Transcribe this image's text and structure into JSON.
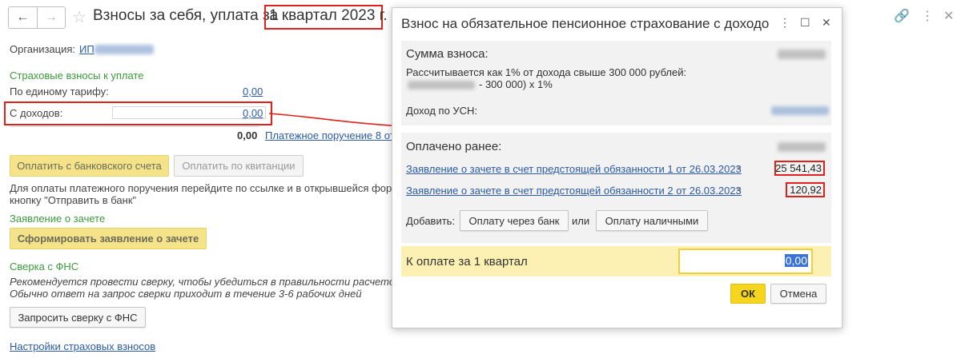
{
  "header": {
    "title": "Взносы за себя, уплата за",
    "title_period": "1 квартал 2023 г.",
    "back_icon": "←",
    "forward_icon": "→",
    "star_icon": "☆",
    "link_icon": "🔗",
    "menu_icon": "⋮",
    "close_icon": "✕"
  },
  "main": {
    "org_label": "Организация:",
    "org_value": "ИП",
    "section_contrib": "Страховые взносы к уплате",
    "single_rate_label": "По единому тарифу:",
    "single_rate_value": "0,00",
    "income_label": "С доходов:",
    "income_value": "0,00",
    "total_value": "0,00",
    "payment_order_link": "Платежное поручение 8 от",
    "pay_bank_button": "Оплатить с банковского счета",
    "pay_receipt_button": "Оплатить по квитанции",
    "instruction_line1": "Для оплаты платежного поручения перейдите по ссылке и в открывшейся форме",
    "instruction_line2": "кнопку \"Отправить в банк\"",
    "section_offset": "Заявление о зачете",
    "make_offset_button": "Сформировать заявление о зачете",
    "section_reconcile": "Сверка с ФНС",
    "reconcile_line1": "Рекомендуется провести сверку, чтобы убедиться в правильности расчетов с",
    "reconcile_line2": "Обычно ответ на запрос сверки приходит в течение 3-6 рабочих дней",
    "request_reconcile_button": "Запросить сверку с ФНС",
    "settings_link": "Настройки страховых взносов"
  },
  "dialog": {
    "title": "Взнос на обязательное пенсионное страхование с доходов",
    "minimize_icon": "_",
    "maximize_icon": "☐",
    "close_icon": "✕",
    "sum_header": "Сумма взноса:",
    "calc_text": "Рассчитывается как 1% от дохода свыше 300 000 рублей:",
    "calc_formula": "- 300 000) x 1%",
    "income_usn_label": "Доход по УСН:",
    "paid_header": "Оплачено ранее:",
    "paid_items": [
      {
        "label": "Заявление о зачете в счет предстоящей обязанности 1 от 26.03.2023",
        "amount": "25 541,43"
      },
      {
        "label": "Заявление о зачете в счет предстоящей обязанности 2 от 26.03.2023",
        "amount": "120,92"
      }
    ],
    "remove_icon": "×",
    "add_label": "Добавить:",
    "add_bank_button": "Оплату через банк",
    "or_label": "или",
    "add_cash_button": "Оплату наличными",
    "to_pay_label": "К оплате за 1 квартал",
    "to_pay_value": "0,00",
    "ok_button": "ОК",
    "cancel_button": "Отмена"
  },
  "colors": {
    "accent_yellow": "#f5e38a",
    "highlight_red": "#e0201a",
    "section_green": "#3b9b3b",
    "link_blue": "#2a5aa8"
  }
}
